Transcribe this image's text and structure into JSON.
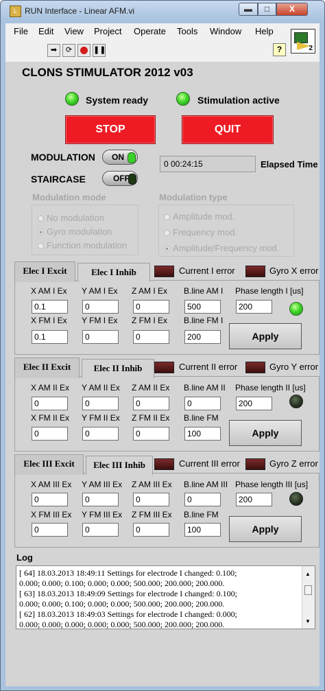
{
  "window": {
    "title": "RUN Interface - Linear AFM.vi",
    "app_icon_text": "L",
    "controls": {
      "minimize": "▬",
      "maximize": "□",
      "close": "X"
    }
  },
  "menu": [
    "File",
    "Edit",
    "View",
    "Project",
    "Operate",
    "Tools",
    "Window",
    "Help"
  ],
  "toolbar": {
    "run_icon": "run-arrow-icon",
    "run_continuous_icon": "run-continuously-icon",
    "abort_icon": "abort-icon",
    "pause_icon": "pause-icon",
    "help_label": "?",
    "vi_icon_text": "2"
  },
  "panel": {
    "title": "CLONS STIMULATOR 2012 v03",
    "status": [
      {
        "label": "System ready",
        "on": true
      },
      {
        "label": "Stimulation active",
        "on": true
      }
    ],
    "stop_label": "STOP",
    "quit_label": "QUIT",
    "modulation_label": "MODULATION",
    "modulation_state": "ON",
    "staircase_label": "STAIRCASE",
    "staircase_state": "OFF",
    "elapsed_value": "0 00:24:15",
    "elapsed_label": "Elapsed Time",
    "mod_mode": {
      "title": "Modulation mode",
      "options": [
        "No modulation",
        "Gyro modulation",
        "Function modulation"
      ],
      "selected_index": 1
    },
    "mod_type": {
      "title": "Modulation type",
      "options": [
        "Amplitude mod.",
        "Frequency mod.",
        "Amplitude/Frequency mod."
      ],
      "selected_index": 2
    }
  },
  "electrodes": [
    {
      "tab_excit": "Elec I Excit",
      "tab_inhib": "Elec I Inhib",
      "current_error": "Current  I error",
      "gyro_error": "Gyro X error",
      "labels": [
        "X AM I Ex",
        "Y AM I Ex",
        "Z AM I Ex",
        "B.line AM I",
        "Phase length I [us]",
        "X FM I Ex",
        "Y FM I Ex",
        "Z FM I Ex",
        "B.line FM I"
      ],
      "values": [
        "0.1",
        "0",
        "0",
        "500",
        "200",
        "0.1",
        "0",
        "0",
        "200"
      ],
      "led_on": true,
      "apply": "Apply"
    },
    {
      "tab_excit": "Elec II Excit",
      "tab_inhib": "Elec II Inhib",
      "current_error": "Current  II error",
      "gyro_error": "Gyro Y error",
      "labels": [
        "X AM II Ex",
        "Y AM II Ex",
        "Z AM II Ex",
        "B.line AM II",
        "Phase length II [us]",
        "X FM II Ex",
        "Y FM II Ex",
        "Z FM II Ex",
        "B.line FM"
      ],
      "values": [
        "0",
        "0",
        "0",
        "0",
        "200",
        "0",
        "0",
        "0",
        "100"
      ],
      "led_on": false,
      "apply": "Apply"
    },
    {
      "tab_excit": "Elec III Excit",
      "tab_inhib": "Elec III Inhib",
      "current_error": "Current  III error",
      "gyro_error": "Gyro Z error",
      "labels": [
        "X AM III Ex",
        "Y AM III Ex",
        "Z AM III Ex",
        "B.line AM III",
        "Phase length III [us]",
        "X FM III Ex",
        "Y FM III Ex",
        "Z FM III Ex",
        "B.line FM"
      ],
      "values": [
        "0",
        "0",
        "0",
        "0",
        "200",
        "0",
        "0",
        "0",
        "100"
      ],
      "led_on": false,
      "apply": "Apply"
    }
  ],
  "log": {
    "title": "Log",
    "lines": [
      "[  64] 18.03.2013  18:49:11    Settings for electrode I changed:   0.100;",
      "0.000;  0.000;  0.100;  0.000;  0.000; 500.000; 200.000; 200.000.",
      "[  63] 18.03.2013  18:49:09    Settings for electrode I changed:   0.100;",
      "0.000;  0.000;  0.100;  0.000;  0.000; 500.000; 200.000; 200.000.",
      "[  62] 18.03.2013  18:49:03    Settings for electrode I changed:   0.000;",
      "0.000;  0.000;  0.000;  0.000;  0.000; 500.000; 200.000; 200.000."
    ]
  }
}
